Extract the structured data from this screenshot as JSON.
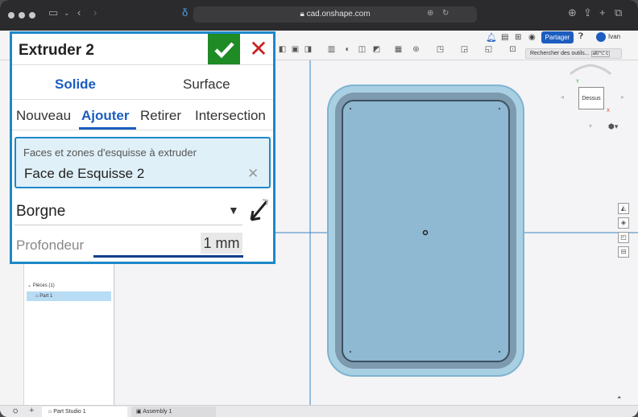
{
  "browser": {
    "url": "cad.onshape.com"
  },
  "toolbar": {
    "share_label": "Partager",
    "user_name": "Ivan",
    "search_placeholder": "Rechercher des outils...",
    "search_shortcut": "alt/⌥ c"
  },
  "dialog": {
    "title": "Extruder 2",
    "tab_solid": "Solide",
    "tab_surface": "Surface",
    "op_new": "Nouveau",
    "op_add": "Ajouter",
    "op_remove": "Retirer",
    "op_intersect": "Intersection",
    "faces_label": "Faces et zones d'esquisse à extruder",
    "faces_value": "Face de Esquisse 2",
    "end_type": "Borgne",
    "depth_label": "Profondeur",
    "depth_value": "1 mm"
  },
  "feature_tree": {
    "parts_header": "Pièces (1)",
    "part_name": "Part 1"
  },
  "viewcube": {
    "face_label": "Dessus",
    "axis_y": "Y",
    "axis_x": "X"
  },
  "tabs": {
    "part_studio": "Part Studio 1",
    "assembly": "Assembly 1"
  },
  "colors": {
    "accent": "#1e88c8",
    "ok": "#1f8b24",
    "cancel": "#c9201f",
    "part": "#7fb1cf"
  }
}
